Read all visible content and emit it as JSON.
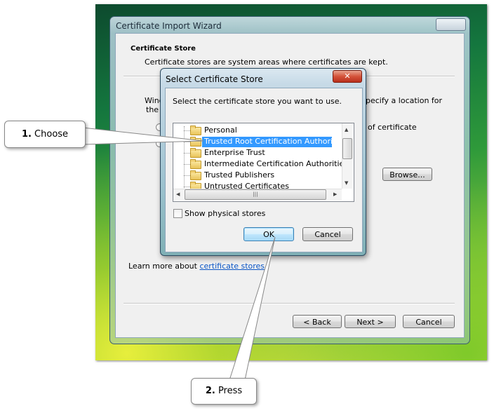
{
  "wizard": {
    "title": "Certificate Import Wizard",
    "heading": "Certificate Store",
    "description": "Certificate stores are system areas where certificates are kept.",
    "partial_text_1a": "Wind",
    "partial_text_1b": "the c",
    "partial_text_2": "pecify a location for",
    "partial_text_3": "of certificate",
    "browse_label": "Browse...",
    "learn_more_prefix": "Learn more about ",
    "learn_more_link": "certificate stores",
    "back_label": "< Back",
    "next_label": "Next >",
    "cancel_label": "Cancel"
  },
  "dialog": {
    "title": "Select Certificate Store",
    "close_glyph": "✕",
    "prompt": "Select the certificate store you want to use.",
    "stores": [
      {
        "label": "Personal",
        "selected": false
      },
      {
        "label": "Trusted Root Certification Authorities",
        "selected": true
      },
      {
        "label": "Enterprise Trust",
        "selected": false
      },
      {
        "label": "Intermediate Certification Authorities",
        "selected": false
      },
      {
        "label": "Trusted Publishers",
        "selected": false
      },
      {
        "label": "Untrusted Certificates",
        "selected": false
      }
    ],
    "show_physical_label": "Show physical stores",
    "show_physical_checked": false,
    "ok_label": "OK",
    "cancel_label": "Cancel"
  },
  "callouts": {
    "step1_number": "1.",
    "step1_text": " Choose",
    "step2_number": "2.",
    "step2_text": " Press"
  },
  "icons": {
    "tree_item": "folder-icon",
    "scroll_up": "arrow-up-icon",
    "scroll_down": "arrow-down-icon",
    "scroll_left": "arrow-left-icon",
    "scroll_right": "arrow-right-icon"
  },
  "colors": {
    "selection": "#3399ff",
    "link": "#0a55c5",
    "close_button": "#d4533a"
  }
}
